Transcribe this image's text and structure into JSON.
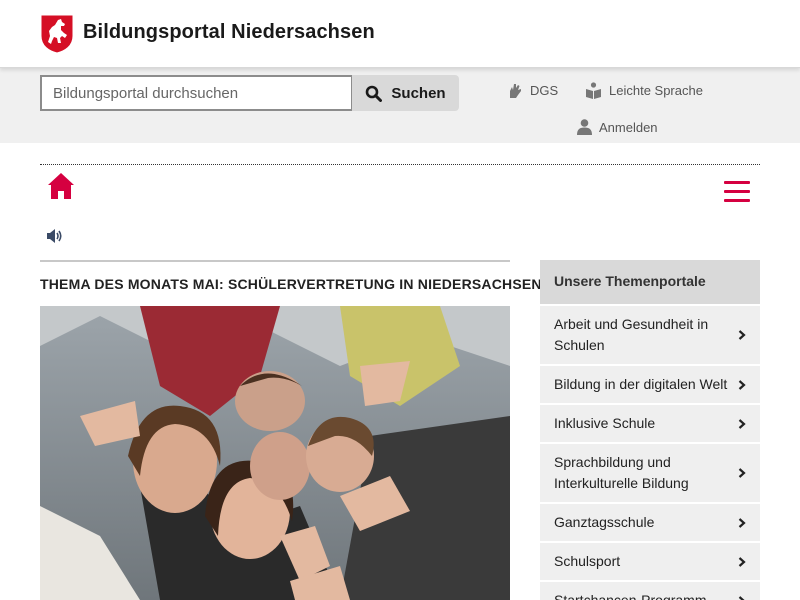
{
  "header": {
    "site_title": "Bildungsportal Niedersachsen",
    "logo_icon": "lower-saxony-horse-crest-icon",
    "logo_colors": {
      "shield": "#d50f25",
      "horse": "#ffffff"
    }
  },
  "toolbar": {
    "search": {
      "placeholder": "Bildungsportal durchsuchen",
      "value": ""
    },
    "search_button_label": "Suchen",
    "links": [
      {
        "label": "DGS",
        "icon": "sign-language-hands-icon"
      },
      {
        "label": "Leichte Sprache",
        "icon": "easy-language-book-icon"
      },
      {
        "label": "Anmelden",
        "icon": "user-icon"
      }
    ]
  },
  "nav": {
    "home_icon": "home-icon",
    "menu_icon": "hamburger-menu-icon",
    "speaker_icon": "speaker-icon"
  },
  "main": {
    "article_title": "THEMA DES MONATS MAI: SCHÜLERVERTRETUNG IN NIEDERSACHSEN",
    "image": "photo-group-of-students-thumbs-up"
  },
  "sidebar": {
    "heading": "Unsere Themenportale",
    "items": [
      {
        "label": "Arbeit und Gesundheit in Schulen"
      },
      {
        "label": "Bildung in der digitalen Welt"
      },
      {
        "label": "Inklusive Schule"
      },
      {
        "label": "Sprachbildung und Interkulturelle Bildung"
      },
      {
        "label": "Ganztagsschule"
      },
      {
        "label": "Schulsport"
      },
      {
        "label": "Startchancen-Programm"
      }
    ]
  },
  "colors": {
    "accent": "#d50040",
    "toolbar_bg": "#f0f0f0",
    "sidebar_heading_bg": "#d9d9d9",
    "sidebar_item_bg": "#efefef",
    "search_button_bg": "#d9d9d9"
  }
}
